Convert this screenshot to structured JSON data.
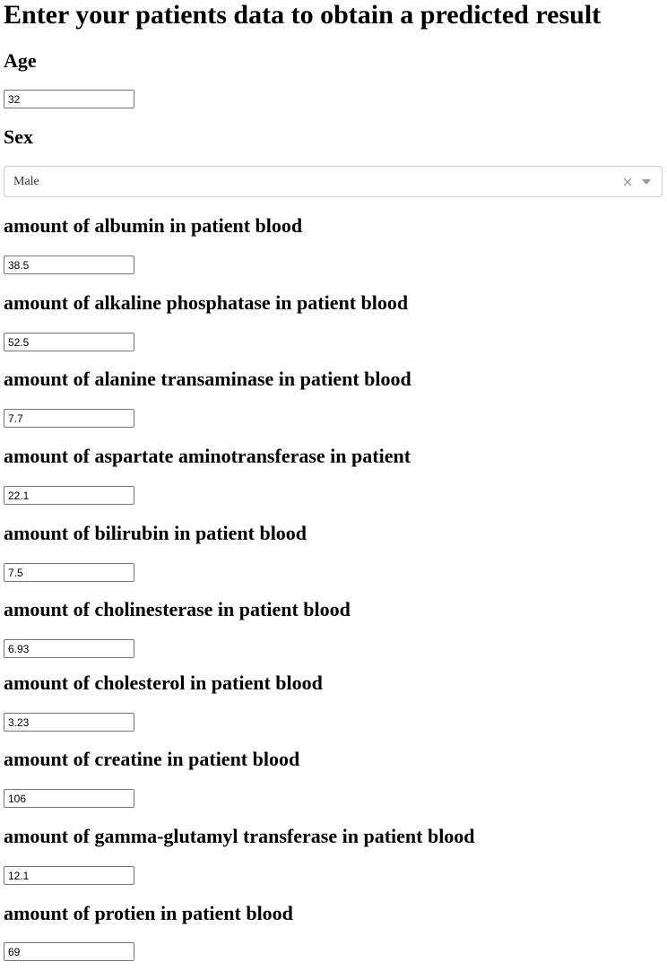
{
  "page": {
    "title": "Enter your patients data to obtain a predicted result"
  },
  "fields": {
    "age": {
      "label": "Age",
      "value": "32"
    },
    "sex": {
      "label": "Sex",
      "value": "Male"
    },
    "albumin": {
      "label": "amount of albumin in patient blood",
      "value": "38.5"
    },
    "alkaline_phosphatase": {
      "label": "amount of alkaline phosphatase in patient blood",
      "value": "52.5"
    },
    "alanine_transaminase": {
      "label": "amount of alanine transaminase in patient blood",
      "value": "7.7"
    },
    "aspartate_aminotransferase": {
      "label": "amount of aspartate aminotransferase in patient",
      "value": "22.1"
    },
    "bilirubin": {
      "label": "amount of bilirubin in patient blood",
      "value": "7.5"
    },
    "cholinesterase": {
      "label": "amount of cholinesterase in patient blood",
      "value": "6.93"
    },
    "cholesterol": {
      "label": "amount of cholesterol in patient blood",
      "value": "3.23"
    },
    "creatine": {
      "label": "amount of creatine in patient blood",
      "value": "106"
    },
    "ggt": {
      "label": "amount of gamma-glutamyl transferase in patient blood",
      "value": "12.1"
    },
    "protien": {
      "label": "amount of protien in patient blood",
      "value": "69"
    }
  },
  "icons": {
    "clear": "close-icon",
    "dropdown": "caret-down-icon"
  },
  "colors": {
    "select_border": "#cccccc",
    "input_border": "#767676",
    "icon": "#999999"
  }
}
